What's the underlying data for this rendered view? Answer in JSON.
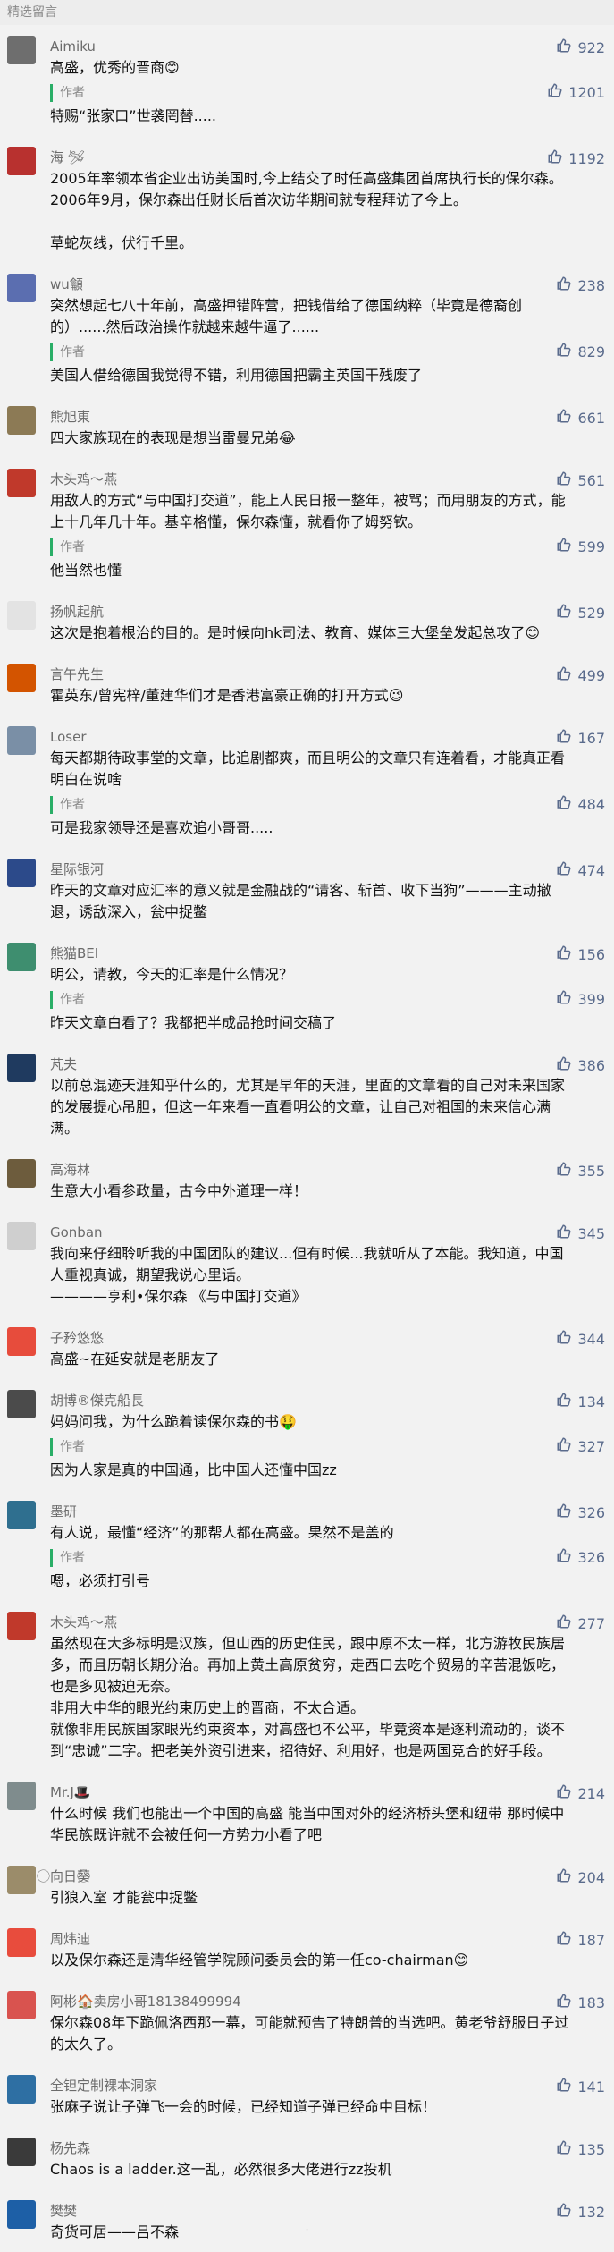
{
  "header": {
    "title": "精选留言"
  },
  "comments": [
    {
      "name": "Aimiku",
      "likes": "922",
      "text": "高盛，优秀的晋商😊",
      "reply": {
        "author": "作者",
        "text": "特赐“张家口”世袭罔替.....",
        "likes": "1201"
      },
      "avatar_color": "#6e6e6e"
    },
    {
      "name": "海 🛩",
      "likes": "1192",
      "text": "2005年率领本省企业出访美国时,今上结交了时任高盛集团首席执行长的保尔森。2006年9月，保尔森出任财长后首次访华期间就专程拜访了今上。\n\n草蛇灰线，伏行千里。",
      "reply": null,
      "avatar_color": "#b8312f"
    },
    {
      "name": "wu龥",
      "likes": "238",
      "text": "突然想起七八十年前，高盛押错阵营，把钱借给了德国纳粹（毕竟是德裔创的）......然后政治操作就越来越牛逼了......",
      "reply": {
        "author": "作者",
        "text": "美国人借给德国我觉得不错，利用德国把霸主英国干残废了",
        "likes": "829"
      },
      "avatar_color": "#5b6eb0"
    },
    {
      "name": "熊旭東",
      "likes": "661",
      "text": "四大家族现在的表现是想当雷曼兄弟😂",
      "reply": null,
      "avatar_color": "#8c7a55"
    },
    {
      "name": "木头鸡～燕",
      "likes": "561",
      "text": "用敌人的方式“与中国打交道”，能上人民日报一整年，被骂；而用朋友的方式，能上十几年几十年。基辛格懂，保尔森懂，就看你了姆努钦。",
      "reply": {
        "author": "作者",
        "text": "他当然也懂",
        "likes": "599"
      },
      "avatar_color": "#c0392b"
    },
    {
      "name": "扬帆起航",
      "likes": "529",
      "text": "这次是抱着根治的目的。是时候向hk司法、教育、媒体三大堡垒发起总攻了😊",
      "reply": null,
      "avatar_color": "#e3e3e3"
    },
    {
      "name": "言午先生",
      "likes": "499",
      "text": "霍英东/曾宪梓/董建华们才是香港富豪正确的打开方式😉",
      "reply": null,
      "avatar_color": "#d35400"
    },
    {
      "name": "Loser",
      "likes": "167",
      "text": "每天都期待政事堂的文章，比追剧都爽，而且明公的文章只有连着看，才能真正看明白在说啥",
      "reply": {
        "author": "作者",
        "text": "可是我家领导还是喜欢追小哥哥.....",
        "likes": "484"
      },
      "avatar_color": "#7a8fa6"
    },
    {
      "name": "星际银河",
      "likes": "474",
      "text": "昨天的文章对应汇率的意义就是金融战的“请客、斩首、收下当狗”———主动撤退，诱敌深入，瓮中捉鳖",
      "reply": null,
      "avatar_color": "#2c4a8a"
    },
    {
      "name": "熊猫BEI",
      "likes": "156",
      "text": "明公，请教，今天的汇率是什么情况？",
      "reply": {
        "author": "作者",
        "text": "昨天文章白看了？我都把半成品抢时间交稿了",
        "likes": "399"
      },
      "avatar_color": "#3e8e6f"
    },
    {
      "name": "芃夫",
      "likes": "386",
      "text": "以前总混迹天涯知乎什么的，尤其是早年的天涯，里面的文章看的自己对未来国家的发展提心吊胆，但这一年来看一直看明公的文章，让自己对祖国的未来信心满满。",
      "reply": null,
      "avatar_color": "#1f3a5f"
    },
    {
      "name": "高海林",
      "likes": "355",
      "text": "生意大小看参政量，古今中外道理一样！",
      "reply": null,
      "avatar_color": "#6d5c3d"
    },
    {
      "name": "Gonban",
      "likes": "345",
      "text": "我向来仔细聆听我的中国团队的建议...但有时候...我就听从了本能。我知道，中国人重视真诚，期望我说心里话。\n————亨利•保尔森 《与中国打交道》",
      "reply": null,
      "avatar_color": "#cfcfcf"
    },
    {
      "name": "子矜悠悠",
      "likes": "344",
      "text": "高盛~在延安就是老朋友了",
      "reply": null,
      "avatar_color": "#e74c3c"
    },
    {
      "name": "胡博®傑克船長",
      "likes": "134",
      "text": "妈妈问我，为什么跪着读保尔森的书🤑",
      "reply": {
        "author": "作者",
        "text": "因为人家是真的中国通，比中国人还懂中国zz",
        "likes": "327"
      },
      "avatar_color": "#4b4b4b"
    },
    {
      "name": "墨研",
      "likes": "326",
      "text": "有人说，最懂“经济”的那帮人都在高盛。果然不是盖的",
      "reply": {
        "author": "作者",
        "text": "嗯，必须打引号",
        "likes": "326"
      },
      "avatar_color": "#2f6f8f"
    },
    {
      "name": "木头鸡～燕",
      "likes": "277",
      "text": "虽然现在大多标明是汉族，但山西的历史住民，跟中原不太一样，北方游牧民族居多，而且历朝长期分治。再加上黄土高原贫穷，走西口去吃个贸易的辛苦混饭吃，也是多见被迫无奈。\n非用大中华的眼光约束历史上的晋商，不太合适。\n就像非用民族国家眼光约束资本，对高盛也不公平，毕竟资本是逐利流动的，谈不到“忠诚”二字。把老美外资引进来，招待好、利用好，也是两国竞合的好手段。",
      "reply": null,
      "avatar_color": "#c0392b"
    },
    {
      "name": "Mr.J🎩",
      "likes": "214",
      "text": "什么时候 我们也能出一个中国的高盛 能当中国对外的经济桥头堡和纽带 那时候中华民族既许就不会被任何一方势力小看了吧",
      "reply": null,
      "avatar_color": "#7f8c8d"
    },
    {
      "name": "⃝向日葵⃝",
      "likes": "204",
      "text": "引狼入室 才能瓮中捉鳖",
      "reply": null,
      "avatar_color": "#9b8c6a"
    },
    {
      "name": "周炜迪",
      "likes": "187",
      "text": "以及保尔森还是清华经管学院顾问委员会的第一任co-chairman😊",
      "reply": null,
      "avatar_color": "#e84c3d"
    },
    {
      "name": "阿彬🏠卖房小哥18138499994",
      "likes": "183",
      "text": "保尔森08年下跪佩洛西那一幕，可能就预告了特朗普的当选吧。黄老爷舒服日子过的太久了。",
      "reply": null,
      "avatar_color": "#d9534f"
    },
    {
      "name": "全钽定制裸本洞家",
      "likes": "141",
      "text": "张麻子说让子弹飞一会的时候，已经知道子弹已经命中目标！",
      "reply": null,
      "avatar_color": "#2e6fa3"
    },
    {
      "name": "杨先森",
      "likes": "135",
      "text": "Chaos is a ladder.这一乱，必然很多大佬进行zz投机",
      "reply": null,
      "avatar_color": "#3a3a3a"
    },
    {
      "name": "樊樊",
      "likes": "132",
      "text": "奇货可居——吕不森",
      "reply": null,
      "avatar_color": "#1d5fa6"
    }
  ]
}
